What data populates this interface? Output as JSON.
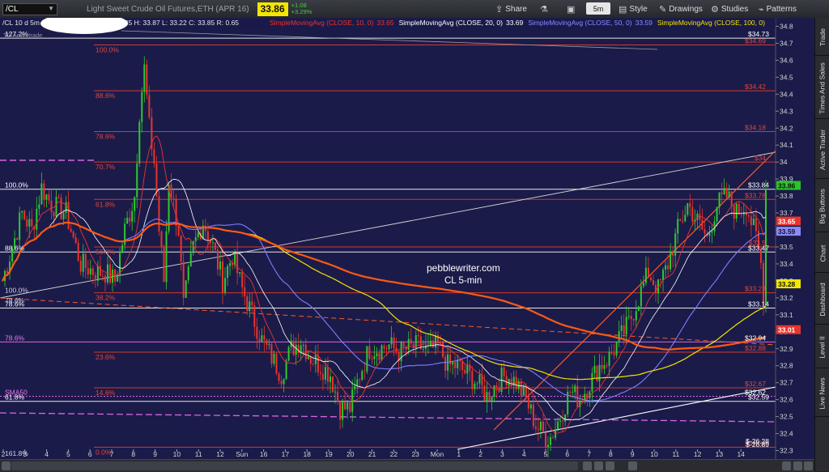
{
  "toolbar": {
    "symbol": "/CL",
    "description": "Light Sweet Crude Oil Futures,ETH (APR 16)",
    "last_price": "33.86",
    "change": "+1.08",
    "change_pct": "+3.29%",
    "share_label": "Share",
    "timeframe": "5m",
    "style_label": "Style",
    "drawings_label": "Drawings",
    "studies_label": "Studies",
    "patterns_label": "Patterns"
  },
  "header": {
    "ohlc": "/CL 10 d 5m   D: 2/29/16 11:25 AM   O: 33.35   H: 33.87   L: 33.22   C: 33.85   R: 0.65",
    "sub": "TD Ameritrade",
    "studies": [
      {
        "label": "SimpleMovingAvg (CLOSE, 10, 0)",
        "value": "33.65",
        "color": "#e8352c"
      },
      {
        "label": "SimpleMovingAvg (CLOSE, 20, 0)",
        "value": "33.69",
        "color": "#ffffff"
      },
      {
        "label": "SimpleMovingAvg (CLOSE, 50, 0)",
        "value": "33.59",
        "color": "#8a8aff"
      },
      {
        "label": "SimpleMovingAvg (CLOSE, 100, 0)",
        "value": "",
        "color": "#f3e600"
      }
    ]
  },
  "sidebar": {
    "tabs": [
      "Trade",
      "Times And Sales",
      "Active Trader",
      "Big Buttons",
      "Chart",
      "Dashboard",
      "Level II",
      "Live News"
    ]
  },
  "watermark": {
    "line1": "pebblewriter.com",
    "line2": "CL 5-min"
  },
  "chart_data": {
    "type": "candlestick",
    "ylim": [
      32.25,
      34.85
    ],
    "y_ticks": [
      "32.3",
      "32.4",
      "32.5",
      "32.6",
      "32.7",
      "32.8",
      "32.9",
      "33",
      "33.1",
      "33.2",
      "33.3",
      "33.4",
      "33.5",
      "33.6",
      "33.7",
      "33.8",
      "33.9",
      "34",
      "34.1",
      "34.2",
      "34.3",
      "34.4",
      "34.5",
      "34.6",
      "34.7",
      "34.8"
    ],
    "x_ticks": [
      "2",
      "3",
      "4",
      "5",
      "6",
      "7",
      "8",
      "9",
      "10",
      "11",
      "12",
      "Sun",
      "16",
      "17",
      "18",
      "19",
      "20",
      "21",
      "22",
      "23",
      "Mon",
      "1",
      "2",
      "3",
      "4",
      "5",
      "6",
      "7",
      "8",
      "9",
      "10",
      "11",
      "12",
      "13",
      "14"
    ],
    "close_path": [
      [
        0,
        33.3
      ],
      [
        4,
        33.5
      ],
      [
        8,
        33.7
      ],
      [
        12,
        33.6
      ],
      [
        16,
        33.85
      ],
      [
        20,
        33.75
      ],
      [
        26,
        33.7
      ],
      [
        32,
        33.4
      ],
      [
        38,
        33.35
      ],
      [
        42,
        33.35
      ],
      [
        46,
        33.3
      ],
      [
        50,
        33.6
      ],
      [
        54,
        33.8
      ],
      [
        56,
        34.3
      ],
      [
        58,
        34.55
      ],
      [
        60,
        34.2
      ],
      [
        62,
        34.0
      ],
      [
        64,
        33.6
      ],
      [
        66,
        33.3
      ],
      [
        68,
        33.9
      ],
      [
        72,
        33.6
      ],
      [
        74,
        33.15
      ],
      [
        78,
        33.5
      ],
      [
        82,
        33.65
      ],
      [
        86,
        33.5
      ],
      [
        90,
        33.3
      ],
      [
        94,
        33.45
      ],
      [
        98,
        33.25
      ],
      [
        102,
        33.1
      ],
      [
        106,
        32.95
      ],
      [
        110,
        32.85
      ],
      [
        114,
        32.75
      ],
      [
        118,
        32.9
      ],
      [
        122,
        32.95
      ],
      [
        126,
        32.85
      ],
      [
        130,
        32.8
      ],
      [
        134,
        32.75
      ],
      [
        138,
        32.55
      ],
      [
        142,
        32.55
      ],
      [
        146,
        32.75
      ],
      [
        150,
        32.9
      ],
      [
        154,
        32.9
      ],
      [
        158,
        32.92
      ],
      [
        162,
        32.88
      ],
      [
        166,
        32.9
      ],
      [
        170,
        32.92
      ],
      [
        174,
        32.88
      ],
      [
        178,
        32.92
      ],
      [
        182,
        32.8
      ],
      [
        186,
        32.8
      ],
      [
        190,
        32.75
      ],
      [
        194,
        32.7
      ],
      [
        198,
        32.62
      ],
      [
        202,
        32.7
      ],
      [
        206,
        32.75
      ],
      [
        210,
        32.7
      ],
      [
        214,
        32.6
      ],
      [
        218,
        32.45
      ],
      [
        222,
        32.38
      ],
      [
        224,
        32.38
      ],
      [
        228,
        32.5
      ],
      [
        232,
        32.65
      ],
      [
        236,
        32.6
      ],
      [
        240,
        32.7
      ],
      [
        244,
        32.8
      ],
      [
        248,
        32.85
      ],
      [
        252,
        32.95
      ],
      [
        256,
        33.05
      ],
      [
        260,
        33.2
      ],
      [
        264,
        33.35
      ],
      [
        268,
        33.25
      ],
      [
        272,
        33.4
      ],
      [
        276,
        33.6
      ],
      [
        280,
        33.75
      ],
      [
        284,
        33.65
      ],
      [
        288,
        33.55
      ],
      [
        292,
        33.75
      ],
      [
        296,
        33.8
      ],
      [
        300,
        33.7
      ],
      [
        304,
        33.75
      ],
      [
        308,
        33.55
      ],
      [
        310,
        33.4
      ],
      [
        311,
        33.22
      ],
      [
        312,
        33.85
      ]
    ],
    "candle_count": 312,
    "fib_levels": [
      {
        "y": 34.69,
        "label": "100.0%",
        "value": "$34.69"
      },
      {
        "y": 34.42,
        "label": "88.6%",
        "value": "$34.42"
      },
      {
        "y": 34.18,
        "label": "78.6%",
        "value": "$34.18"
      },
      {
        "y": 34.0,
        "label": "70.7%",
        "value": "$34"
      },
      {
        "y": 33.78,
        "label": "61.8%",
        "value": "$33.78"
      },
      {
        "y": 33.5,
        "label": "50.0%",
        "value": "$33.5"
      },
      {
        "y": 33.23,
        "label": "38.2%",
        "value": "$33.23"
      },
      {
        "y": 32.88,
        "label": "23.6%",
        "value": "$32.88"
      },
      {
        "y": 32.67,
        "label": "14.6%",
        "value": "$32.67"
      },
      {
        "y": 32.32,
        "label": "0.0%",
        "value": "$32.32"
      }
    ],
    "white_levels": [
      {
        "y": 34.73,
        "label": "127.2%",
        "value": "$34.73"
      },
      {
        "y": 33.84,
        "label": "100.0%",
        "value": "$33.84"
      },
      {
        "y": 33.47,
        "label": "88.6%",
        "value": "$33.47"
      },
      {
        "y": 33.14,
        "label": "78.6%",
        "value": "$33.14"
      },
      {
        "y": 32.59,
        "label": "61.8%",
        "value": "$32.59"
      }
    ],
    "magenta_levels": [
      {
        "y": 32.94,
        "label": "78.6%",
        "value": "$32.94"
      },
      {
        "y": 32.62,
        "label": "SMA50",
        "value": "$32.62"
      }
    ],
    "other_labels": [
      {
        "text": "100.0%",
        "y": 33.23
      },
      {
        "text": "78.6%",
        "y": 33.17
      },
      {
        "text": "161.8%",
        "y": 32.27
      }
    ],
    "axis_badges": [
      {
        "value": "33.86",
        "bg": "#29c429",
        "fg": "#111"
      },
      {
        "value": "33.65",
        "bg": "#e8352c",
        "fg": "#fff"
      },
      {
        "value": "33.59",
        "bg": "#8a8aff",
        "fg": "#111"
      },
      {
        "value": "33.28",
        "bg": "#f3e600",
        "fg": "#111"
      },
      {
        "value": "33.01",
        "bg": "#e8352c",
        "fg": "#fff"
      }
    ],
    "bottom_right_values": [
      "$-26.28",
      "$-26.89"
    ]
  }
}
